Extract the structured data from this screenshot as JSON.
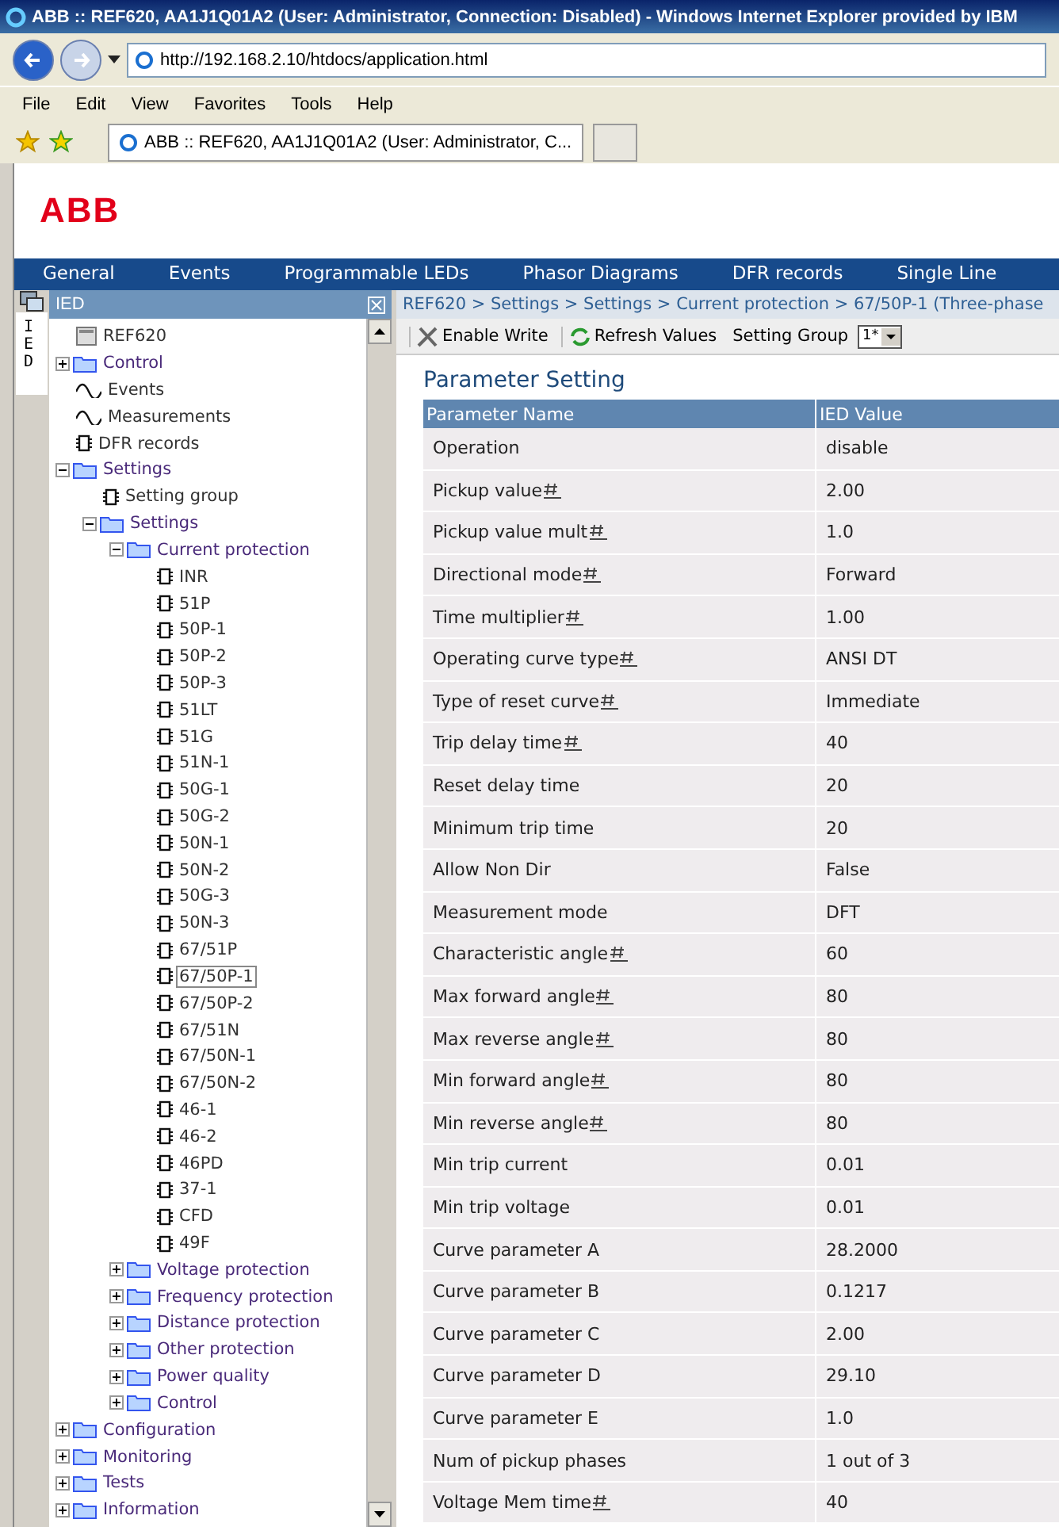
{
  "window": {
    "title": "ABB :: REF620, AA1J1Q01A2 (User: Administrator, Connection: Disabled) - Windows Internet Explorer provided by IBM"
  },
  "address": {
    "value": "http://192.168.2.10/htdocs/application.html"
  },
  "menu": [
    "File",
    "Edit",
    "View",
    "Favorites",
    "Tools",
    "Help"
  ],
  "browser_tab": {
    "title": "ABB :: REF620, AA1J1Q01A2 (User: Administrator, C..."
  },
  "logo": "ABB",
  "nav": [
    {
      "label": "General",
      "selected": false
    },
    {
      "label": "Events",
      "selected": false
    },
    {
      "label": "Programmable LEDs",
      "selected": false
    },
    {
      "label": "Phasor Diagrams",
      "selected": false
    },
    {
      "label": "DFR records",
      "selected": false
    },
    {
      "label": "Single Line",
      "selected": false
    }
  ],
  "panel": {
    "title": "IED",
    "side_tab": "IED"
  },
  "tree": [
    {
      "label": "REF620",
      "kind": "device",
      "selected": false,
      "children": [
        {
          "label": "Control",
          "kind": "folder",
          "expanded": false,
          "selected": false
        },
        {
          "label": "Events",
          "kind": "wave",
          "selected": false
        },
        {
          "label": "Measurements",
          "kind": "wave",
          "selected": false
        },
        {
          "label": "DFR records",
          "kind": "chip",
          "selected": false
        },
        {
          "label": "Settings",
          "kind": "folder",
          "expanded": true,
          "selected": false,
          "children": [
            {
              "label": "Setting group",
              "kind": "chip",
              "selected": false
            },
            {
              "label": "Settings",
              "kind": "folder",
              "expanded": true,
              "selected": false,
              "children": [
                {
                  "label": "Current protection",
                  "kind": "folder",
                  "expanded": true,
                  "selected": false,
                  "children": [
                    {
                      "label": "INR",
                      "kind": "chip",
                      "selected": false
                    },
                    {
                      "label": "51P",
                      "kind": "chip",
                      "selected": false
                    },
                    {
                      "label": "50P-1",
                      "kind": "chip",
                      "selected": false
                    },
                    {
                      "label": "50P-2",
                      "kind": "chip",
                      "selected": false
                    },
                    {
                      "label": "50P-3",
                      "kind": "chip",
                      "selected": false
                    },
                    {
                      "label": "51LT",
                      "kind": "chip",
                      "selected": false
                    },
                    {
                      "label": "51G",
                      "kind": "chip",
                      "selected": false
                    },
                    {
                      "label": "51N-1",
                      "kind": "chip",
                      "selected": false
                    },
                    {
                      "label": "50G-1",
                      "kind": "chip",
                      "selected": false
                    },
                    {
                      "label": "50G-2",
                      "kind": "chip",
                      "selected": false
                    },
                    {
                      "label": "50N-1",
                      "kind": "chip",
                      "selected": false
                    },
                    {
                      "label": "50N-2",
                      "kind": "chip",
                      "selected": false
                    },
                    {
                      "label": "50G-3",
                      "kind": "chip",
                      "selected": false
                    },
                    {
                      "label": "50N-3",
                      "kind": "chip",
                      "selected": false
                    },
                    {
                      "label": "67/51P",
                      "kind": "chip",
                      "selected": false
                    },
                    {
                      "label": "67/50P-1",
                      "kind": "chip",
                      "selected": true
                    },
                    {
                      "label": "67/50P-2",
                      "kind": "chip",
                      "selected": false
                    },
                    {
                      "label": "67/51N",
                      "kind": "chip",
                      "selected": false
                    },
                    {
                      "label": "67/50N-1",
                      "kind": "chip",
                      "selected": false
                    },
                    {
                      "label": "67/50N-2",
                      "kind": "chip",
                      "selected": false
                    },
                    {
                      "label": "46-1",
                      "kind": "chip",
                      "selected": false
                    },
                    {
                      "label": "46-2",
                      "kind": "chip",
                      "selected": false
                    },
                    {
                      "label": "46PD",
                      "kind": "chip",
                      "selected": false
                    },
                    {
                      "label": "37-1",
                      "kind": "chip",
                      "selected": false
                    },
                    {
                      "label": "CFD",
                      "kind": "chip",
                      "selected": false
                    },
                    {
                      "label": "49F",
                      "kind": "chip",
                      "selected": false
                    }
                  ]
                },
                {
                  "label": "Voltage protection",
                  "kind": "folder",
                  "expanded": false,
                  "selected": false
                },
                {
                  "label": "Frequency protection",
                  "kind": "folder",
                  "expanded": false,
                  "selected": false
                },
                {
                  "label": "Distance protection",
                  "kind": "folder",
                  "expanded": false,
                  "selected": false
                },
                {
                  "label": "Other protection",
                  "kind": "folder",
                  "expanded": false,
                  "selected": false
                },
                {
                  "label": "Power quality",
                  "kind": "folder",
                  "expanded": false,
                  "selected": false
                },
                {
                  "label": "Control",
                  "kind": "folder",
                  "expanded": false,
                  "selected": false
                }
              ]
            }
          ]
        },
        {
          "label": "Configuration",
          "kind": "folder",
          "expanded": false,
          "selected": false
        },
        {
          "label": "Monitoring",
          "kind": "folder",
          "expanded": false,
          "selected": false
        },
        {
          "label": "Tests",
          "kind": "folder",
          "expanded": false,
          "selected": false
        },
        {
          "label": "Information",
          "kind": "folder",
          "expanded": false,
          "selected": false
        }
      ]
    }
  ],
  "breadcrumb": "REF620 > Settings > Settings > Current protection > 67/50P-1 (Three-phase",
  "toolbar": {
    "enable_write": "Enable Write",
    "refresh": "Refresh Values",
    "group_label": "Setting Group",
    "group_value": "1*"
  },
  "heading": "Parameter Setting",
  "table": {
    "columns": [
      "Parameter Name",
      "IED Value"
    ],
    "rows": [
      {
        "name": "Operation",
        "value": "disable",
        "editable": false
      },
      {
        "name": "Pickup value",
        "value": "2.00",
        "editable": true
      },
      {
        "name": "Pickup value mult",
        "value": "1.0",
        "editable": true
      },
      {
        "name": "Directional mode",
        "value": "Forward",
        "editable": true
      },
      {
        "name": "Time multiplier",
        "value": "1.00",
        "editable": true
      },
      {
        "name": "Operating curve type",
        "value": "ANSI DT",
        "editable": true
      },
      {
        "name": "Type of reset curve",
        "value": "Immediate",
        "editable": true
      },
      {
        "name": "Trip delay time",
        "value": "40",
        "editable": true
      },
      {
        "name": "Reset delay time",
        "value": "20",
        "editable": false
      },
      {
        "name": "Minimum trip time",
        "value": "20",
        "editable": false
      },
      {
        "name": "Allow Non Dir",
        "value": "False",
        "editable": false
      },
      {
        "name": "Measurement mode",
        "value": "DFT",
        "editable": false
      },
      {
        "name": "Characteristic angle",
        "value": "60",
        "editable": true
      },
      {
        "name": "Max forward angle",
        "value": "80",
        "editable": true
      },
      {
        "name": "Max reverse angle",
        "value": "80",
        "editable": true
      },
      {
        "name": "Min forward angle",
        "value": "80",
        "editable": true
      },
      {
        "name": "Min reverse angle",
        "value": "80",
        "editable": true
      },
      {
        "name": "Min trip current",
        "value": "0.01",
        "editable": false
      },
      {
        "name": "Min trip voltage",
        "value": "0.01",
        "editable": false
      },
      {
        "name": "Curve parameter A",
        "value": "28.2000",
        "editable": false
      },
      {
        "name": "Curve parameter B",
        "value": "0.1217",
        "editable": false
      },
      {
        "name": "Curve parameter C",
        "value": "2.00",
        "editable": false
      },
      {
        "name": "Curve parameter D",
        "value": "29.10",
        "editable": false
      },
      {
        "name": "Curve parameter E",
        "value": "1.0",
        "editable": false
      },
      {
        "name": "Num of pickup phases",
        "value": "1 out of 3",
        "editable": false
      },
      {
        "name": "Voltage Mem time",
        "value": "40",
        "editable": true
      }
    ]
  }
}
